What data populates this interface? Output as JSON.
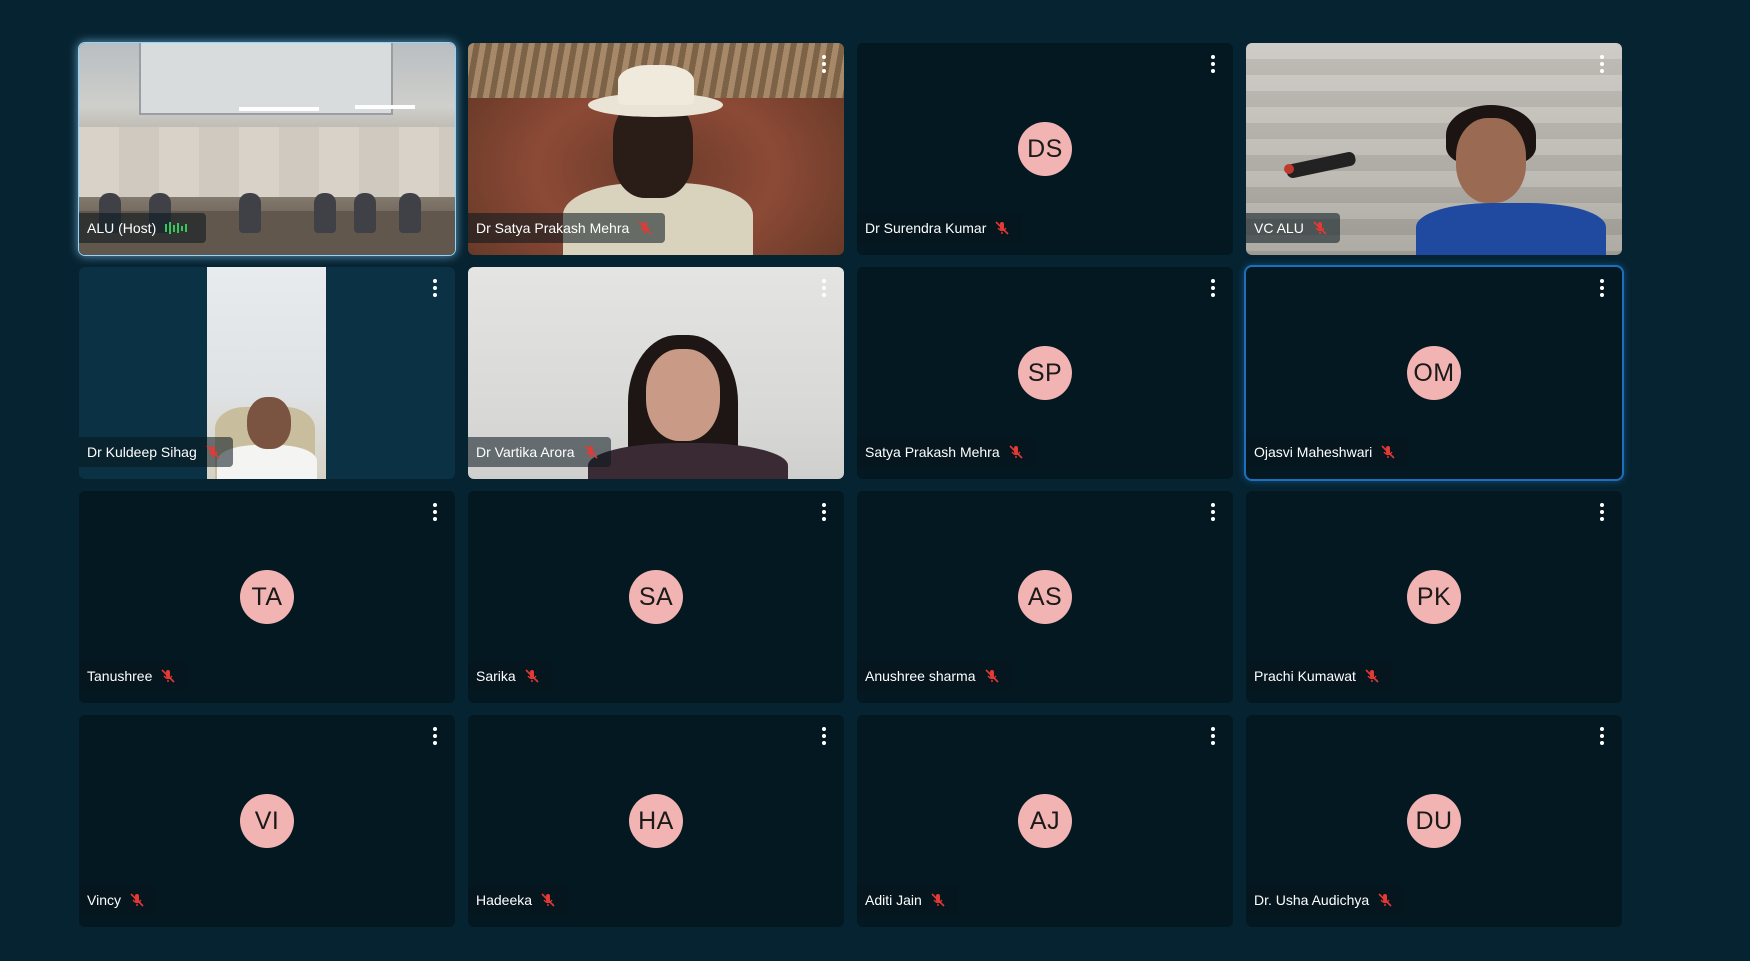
{
  "participants": [
    {
      "name": "ALU (Host)",
      "initials": "",
      "video": "conference-room",
      "audio": "speaking"
    },
    {
      "name": "Dr Satya Prakash Mehra",
      "initials": "",
      "video": "man-hat",
      "audio": "muted"
    },
    {
      "name": "Dr Surendra Kumar",
      "initials": "DS",
      "video": "",
      "audio": "muted"
    },
    {
      "name": "VC ALU",
      "initials": "",
      "video": "woman-mic",
      "audio": "muted"
    },
    {
      "name": "Dr Kuldeep Sihag",
      "initials": "",
      "video": "man-portrait",
      "audio": "muted"
    },
    {
      "name": "Dr Vartika Arora",
      "initials": "",
      "video": "woman-portrait",
      "audio": "muted"
    },
    {
      "name": "Satya Prakash Mehra",
      "initials": "SP",
      "video": "",
      "audio": "muted"
    },
    {
      "name": "Ojasvi Maheshwari",
      "initials": "OM",
      "video": "",
      "audio": "muted"
    },
    {
      "name": "Tanushree",
      "initials": "TA",
      "video": "",
      "audio": "muted"
    },
    {
      "name": "Sarika",
      "initials": "SA",
      "video": "",
      "audio": "muted"
    },
    {
      "name": "Anushree sharma",
      "initials": "AS",
      "video": "",
      "audio": "muted"
    },
    {
      "name": "Prachi Kumawat",
      "initials": "PK",
      "video": "",
      "audio": "muted"
    },
    {
      "name": "Vincy",
      "initials": "VI",
      "video": "",
      "audio": "muted"
    },
    {
      "name": "Hadeeka",
      "initials": "HA",
      "video": "",
      "audio": "muted"
    },
    {
      "name": "Aditi Jain",
      "initials": "AJ",
      "video": "",
      "audio": "muted"
    },
    {
      "name": "Dr. Usha Audichya",
      "initials": "DU",
      "video": "",
      "audio": "muted"
    }
  ],
  "colors": {
    "background": "#062331",
    "tile": "#031821",
    "avatar": "#f2b3b3",
    "muted_icon": "#e53935",
    "speaking_icon": "#34c759",
    "active_border": "#1c6fb8"
  },
  "icons": {
    "menu": "more-vert-icon",
    "muted": "mic-muted-icon",
    "speaking": "audio-level-icon"
  }
}
